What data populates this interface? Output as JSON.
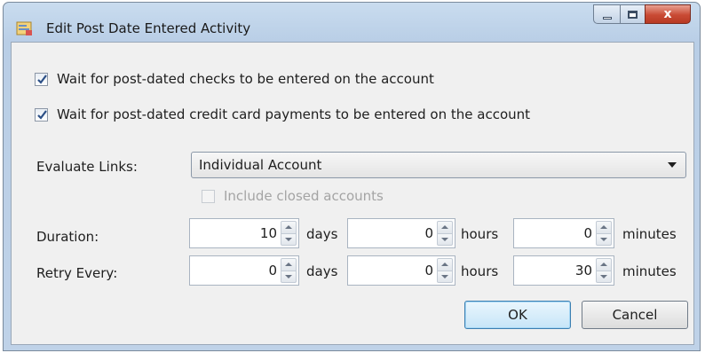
{
  "window": {
    "title": "Edit Post Date Entered Activity",
    "close_glyph": "x"
  },
  "checkboxes": {
    "wait_checks": {
      "label": "Wait for post-dated checks to be entered on the account",
      "checked": true
    },
    "wait_credit_card": {
      "label": "Wait for post-dated credit card payments to be entered on the account",
      "checked": true
    },
    "include_closed": {
      "label": "Include closed accounts",
      "checked": false,
      "enabled": false
    }
  },
  "evaluate_links": {
    "label": "Evaluate Links:",
    "selected": "Individual Account"
  },
  "duration": {
    "label": "Duration:",
    "days": "10",
    "hours": "0",
    "minutes": "0"
  },
  "retry": {
    "label": "Retry Every:",
    "days": "0",
    "hours": "0",
    "minutes": "30"
  },
  "units": {
    "days": "days",
    "hours": "hours",
    "minutes": "minutes"
  },
  "buttons": {
    "ok": "OK",
    "cancel": "Cancel"
  },
  "colors": {
    "title_bar": "#bfd2e8",
    "close_button": "#c94a34",
    "default_button_border": "#3c7fb1"
  }
}
